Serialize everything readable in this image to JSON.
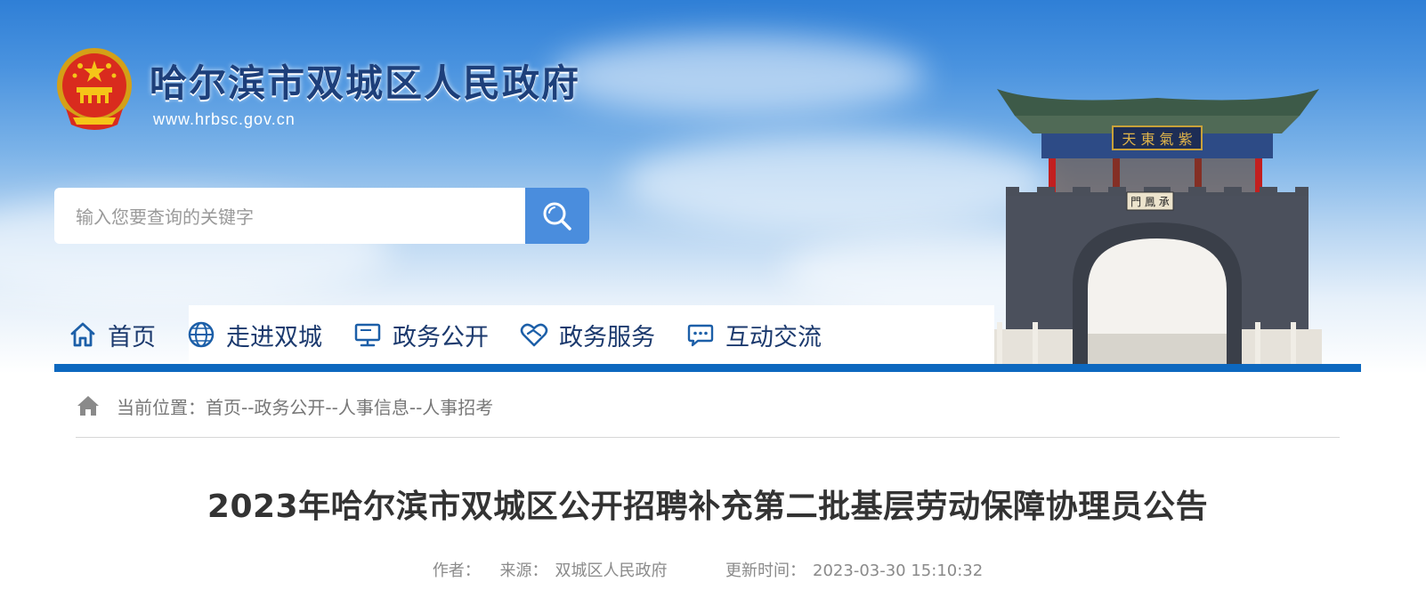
{
  "header": {
    "site_title": "哈尔滨市双城区人民政府",
    "site_url": "www.hrbsc.gov.cn"
  },
  "search": {
    "placeholder": "输入您要查询的关键字",
    "button_icon": "search-icon"
  },
  "nav": {
    "items": [
      {
        "label": "首页",
        "icon": "home-icon"
      },
      {
        "label": "走进双城",
        "icon": "globe-icon"
      },
      {
        "label": "政务公开",
        "icon": "monitor-icon"
      },
      {
        "label": "政务服务",
        "icon": "heart-handshake-icon"
      },
      {
        "label": "互动交流",
        "icon": "chat-bubble-icon"
      }
    ]
  },
  "breadcrumb": {
    "icon": "home-icon",
    "text": "当前位置：首页--政务公开--人事信息--人事招考"
  },
  "article": {
    "title": "2023年哈尔滨市双城区公开招聘补充第二批基层劳动保障协理员公告",
    "author_label": "作者：",
    "author": "",
    "source_label": "来源：",
    "source": "双城区人民政府",
    "updated_label": "更新时间：",
    "updated": "2023-03-30 15:10:32"
  },
  "colors": {
    "nav_bar": "#0d68bf",
    "nav_text": "#1c3a6e",
    "search_button": "#4a8ddd",
    "title_text": "#333333"
  }
}
